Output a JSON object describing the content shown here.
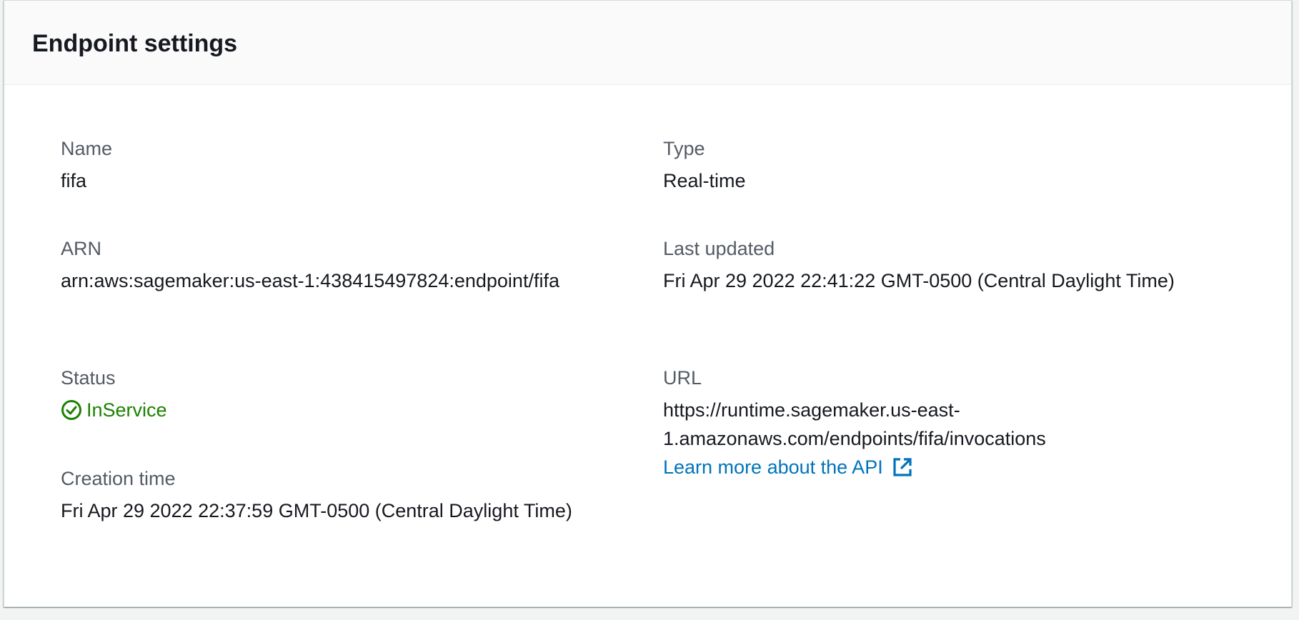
{
  "panel": {
    "title": "Endpoint settings"
  },
  "fields": {
    "name": {
      "label": "Name",
      "value": "fifa"
    },
    "type": {
      "label": "Type",
      "value": "Real-time"
    },
    "arn": {
      "label": "ARN",
      "value": "arn:aws:sagemaker:us-east-1:438415497824:endpoint/fifa"
    },
    "last_updated": {
      "label": "Last updated",
      "value": "Fri Apr 29 2022 22:41:22 GMT-0500 (Central Daylight Time)"
    },
    "status": {
      "label": "Status",
      "value": "InService",
      "icon": "check-circle-icon",
      "color": "#1d8102"
    },
    "url": {
      "label": "URL",
      "value_line1": "https://runtime.sagemaker.us-east-",
      "value_line2": "1.amazonaws.com/endpoints/fifa/invocations",
      "link_text": "Learn more about the API",
      "link_icon": "external-link-icon",
      "link_color": "#0073bb"
    },
    "creation_time": {
      "label": "Creation time",
      "value": "Fri Apr 29 2022 22:37:59 GMT-0500 (Central Daylight Time)"
    }
  }
}
